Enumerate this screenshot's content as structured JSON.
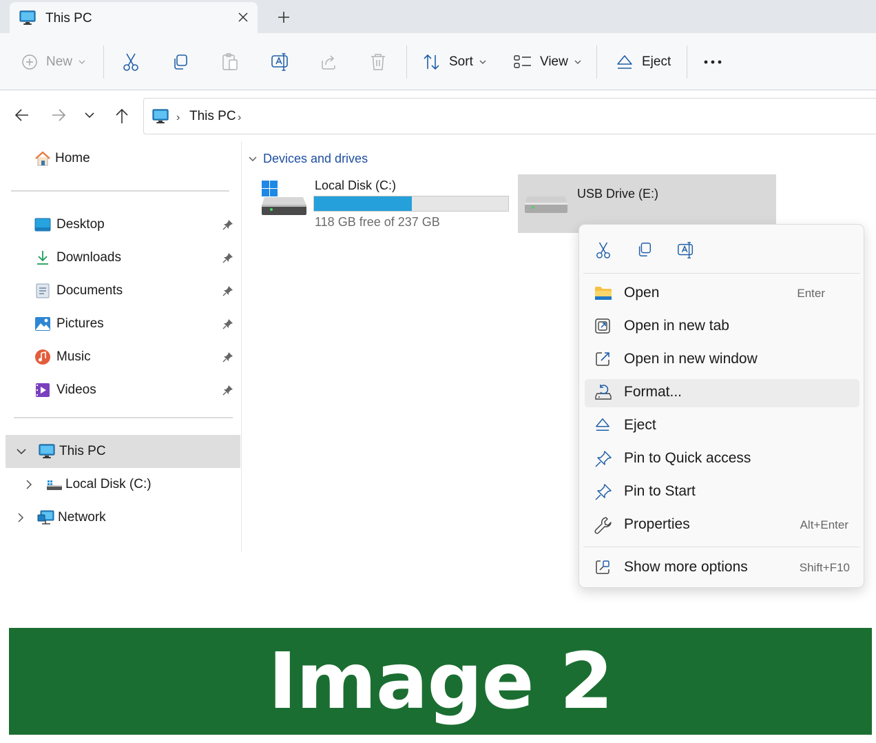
{
  "window": {
    "tab_title": "This PC",
    "tab_icon": "monitor-icon",
    "new_tab_symbol": "+"
  },
  "toolbar": {
    "new_label": "New",
    "sort_label": "Sort",
    "view_label": "View",
    "eject_label": "Eject",
    "icons": [
      "plus-circle-icon",
      "cut-icon",
      "copy-icon",
      "paste-icon",
      "rename-icon",
      "share-icon",
      "delete-icon",
      "sort-icon",
      "view-icon",
      "eject-icon",
      "more-icon"
    ]
  },
  "address": {
    "location": "This PC",
    "separator": "›"
  },
  "sidebar": {
    "home_label": "Home",
    "quick_access": [
      {
        "label": "Desktop",
        "icon": "desktop-icon"
      },
      {
        "label": "Downloads",
        "icon": "downloads-icon"
      },
      {
        "label": "Documents",
        "icon": "documents-icon"
      },
      {
        "label": "Pictures",
        "icon": "pictures-icon"
      },
      {
        "label": "Music",
        "icon": "music-icon"
      },
      {
        "label": "Videos",
        "icon": "videos-icon"
      }
    ],
    "tree": {
      "this_pc": "This PC",
      "local_disk": "Local Disk (C:)",
      "network": "Network"
    }
  },
  "content": {
    "group_title": "Devices and drives",
    "drives": [
      {
        "name": "Local Disk (C:)",
        "free_text": "118 GB free of 237 GB",
        "used_fraction": 0.502
      },
      {
        "name": "USB Drive (E:)"
      }
    ]
  },
  "context_menu": {
    "top_icons": [
      "cut-icon",
      "copy-icon",
      "rename-icon"
    ],
    "items": [
      {
        "label": "Open",
        "shortcut": "Enter",
        "icon": "folder-icon"
      },
      {
        "label": "Open in new tab",
        "shortcut": "",
        "icon": "open-new-tab-icon"
      },
      {
        "label": "Open in new window",
        "shortcut": "",
        "icon": "open-new-window-icon"
      },
      {
        "label": "Format...",
        "shortcut": "",
        "icon": "format-icon"
      },
      {
        "label": "Eject",
        "shortcut": "",
        "icon": "eject-icon"
      },
      {
        "label": "Pin to Quick access",
        "shortcut": "",
        "icon": "pin-icon"
      },
      {
        "label": "Pin to Start",
        "shortcut": "",
        "icon": "pin-start-icon"
      },
      {
        "label": "Properties",
        "shortcut": "Alt+Enter",
        "icon": "wrench-icon"
      },
      {
        "label": "Show more options",
        "shortcut": "Shift+F10",
        "icon": "more-options-icon"
      }
    ]
  },
  "banner": {
    "text": "Image 2",
    "color": "#1b6e31"
  },
  "colors": {
    "accent": "#0067c0",
    "usage_bar": "#26a0da",
    "selection": "#d9d9d9"
  }
}
